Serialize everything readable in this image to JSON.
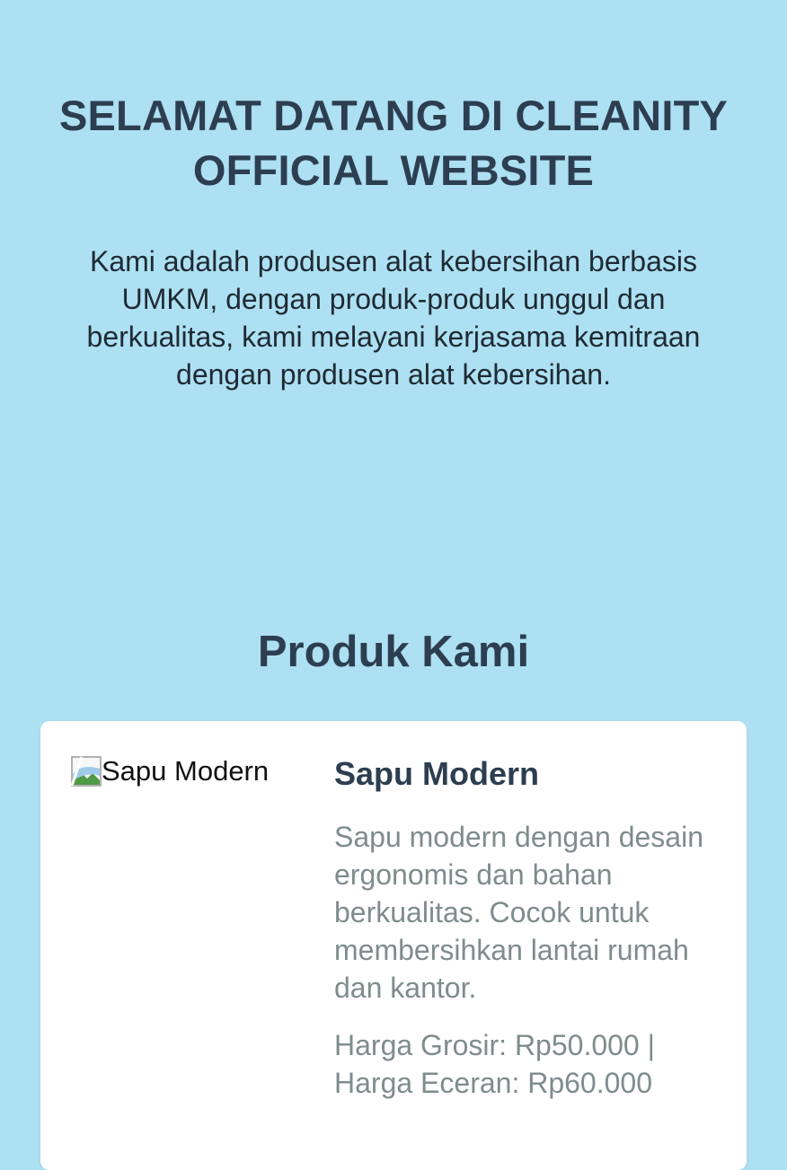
{
  "hero": {
    "title": "SELAMAT DATANG DI CLEANITY OFFICIAL WEBSITE",
    "description": "Kami adalah produsen alat kebersihan berbasis UMKM, dengan produk-produk unggul dan berkualitas, kami melayani kerjasama kemitraan dengan produsen alat kebersihan."
  },
  "products": {
    "title": "Produk Kami",
    "items": [
      {
        "image_alt": "Sapu Modern",
        "image_icon": "broken-image-icon",
        "name": "Sapu Modern",
        "description": "Sapu modern dengan desain ergonomis dan bahan berkualitas. Cocok untuk membersihkan lantai rumah dan kantor.",
        "price": "Harga Grosir: Rp50.000 | Harga Eceran: Rp60.000"
      }
    ]
  },
  "colors": {
    "background": "#ade0f2",
    "heading": "#2c3e50",
    "muted_text": "#7f8c8d",
    "card": "#ffffff"
  }
}
